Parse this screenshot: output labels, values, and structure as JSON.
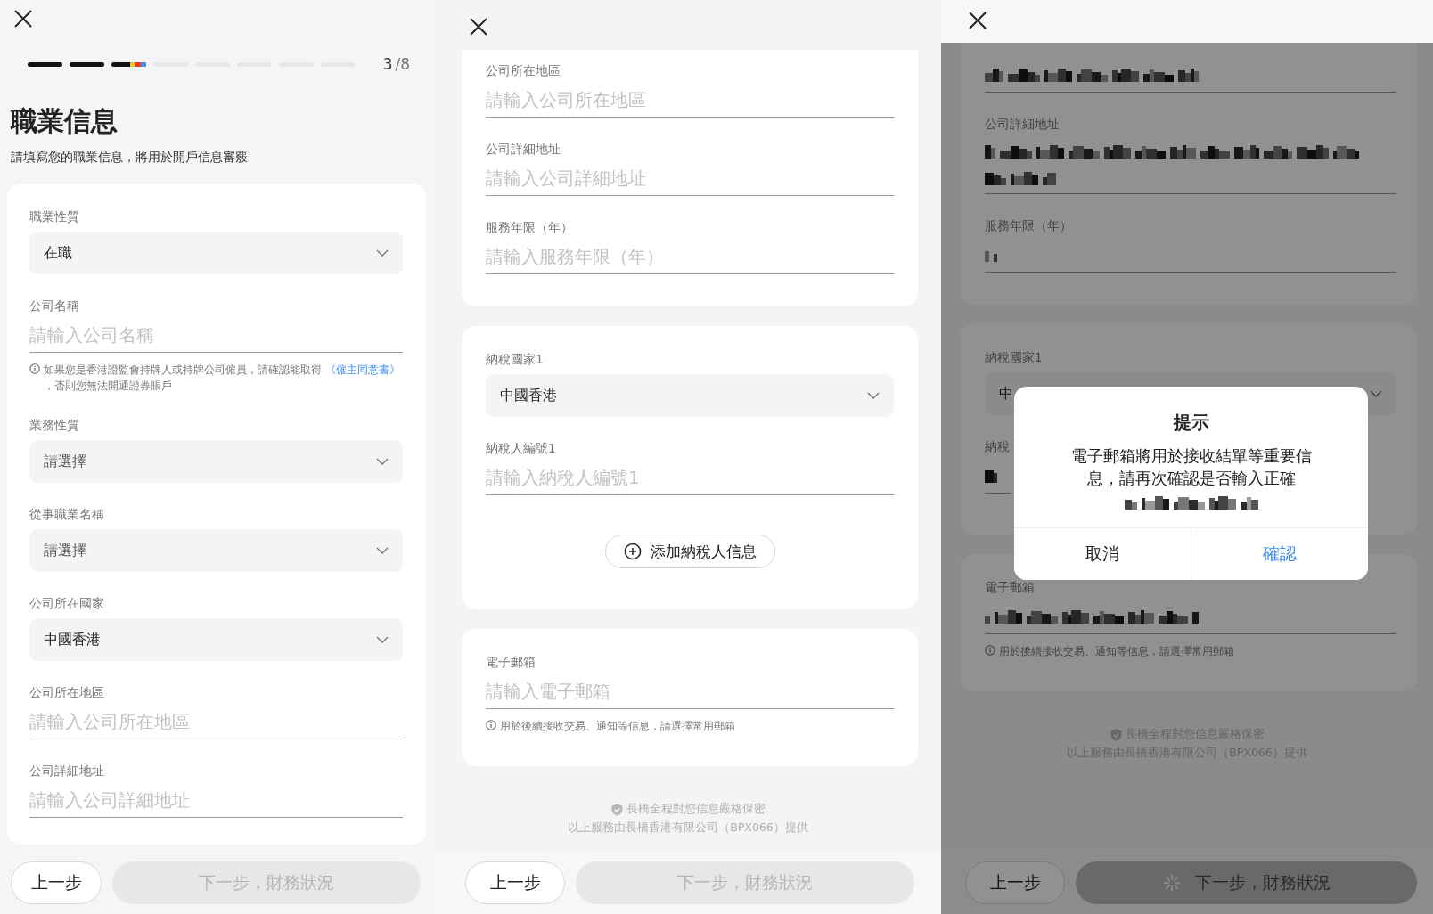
{
  "panels": [
    {
      "kind": "start",
      "progress": {
        "steps": [
          {
            "done": true,
            "selected": false
          },
          {
            "done": true,
            "selected": false
          },
          {
            "selected": true
          },
          {
            "done": false,
            "selected": false
          },
          {
            "done": false,
            "selected": false
          },
          {
            "done": false,
            "selected": false
          },
          {
            "done": false,
            "selected": false
          },
          {
            "done": false,
            "selected": false
          }
        ],
        "current": "3",
        "total": "/8"
      },
      "title": "職業信息",
      "subtitle": "請填寫您的職業信息，將用於開戶信息審覈",
      "cards": [
        {
          "fields": [
            {
              "kind": "select",
              "label": "職業性質",
              "value": "在職"
            },
            {
              "kind": "input",
              "label": "公司名稱",
              "placeholder": "請輸入公司名稱",
              "note": {
                "text": "如果您是香港證監會持牌人或持牌公司僱員，請確認能取得 ",
                "link": "《僱主同意書》",
                "after": " ，否則您無法開通證券賬戶"
              }
            },
            {
              "kind": "select",
              "label": "業務性質",
              "placeholder": "請選擇"
            },
            {
              "kind": "select",
              "label": "從事職業名稱",
              "placeholder": "請選擇"
            },
            {
              "kind": "select",
              "label": "公司所在國家",
              "value": "中國香港"
            },
            {
              "kind": "input",
              "label": "公司所在地區",
              "placeholder": "請輸入公司所在地區"
            },
            {
              "kind": "input",
              "label": "公司詳細地址",
              "placeholder": "請輸入公司詳細地址"
            }
          ]
        }
      ],
      "back_button": "上一步",
      "next_button": {
        "label": "下一步，財務狀況",
        "loading": false
      }
    },
    {
      "kind": "scrolled",
      "cards": [
        {
          "fields": [
            {
              "kind": "input",
              "label": "公司所在地區",
              "placeholder": "請輸入公司所在地區"
            },
            {
              "kind": "input",
              "label": "公司詳細地址",
              "placeholder": "請輸入公司詳細地址"
            },
            {
              "kind": "input",
              "label": "服務年限（年）",
              "placeholder": "請輸入服務年限（年）"
            }
          ]
        },
        {
          "fields": [
            {
              "kind": "select",
              "label": "納稅國家1",
              "value": "中國香港"
            },
            {
              "kind": "input",
              "label": "納稅人編號1",
              "placeholder": "請輸入納稅人編號1"
            }
          ],
          "add_button": "添加納稅人信息"
        },
        {
          "fields": [
            {
              "kind": "input",
              "label": "電子郵箱",
              "placeholder": "請輸入電子郵箱",
              "note": {
                "text": "用於後續接收交易、通知等信息，請選擇常用郵箱"
              }
            }
          ]
        }
      ],
      "footer": {
        "line1": "長橋全程對您信息嚴格保密",
        "line2": "以上服務由長橋香港有限公司（BPX066）提供"
      },
      "back_button": "上一步",
      "next_button": {
        "label": "下一步，財務狀況",
        "loading": false
      }
    },
    {
      "kind": "scrolled-dim",
      "cards": [
        {
          "fields": [
            {
              "kind": "masked"
            },
            {
              "kind": "masked2",
              "label": "公司詳細地址"
            },
            {
              "kind": "maskedtiny",
              "label": "服務年限（年）"
            }
          ]
        },
        {
          "fields": [
            {
              "kind": "select",
              "label": "納稅國家1",
              "value": "中"
            },
            {
              "kind": "maskedpartial",
              "label": "納稅"
            }
          ]
        },
        {
          "fields": [
            {
              "kind": "masked",
              "label": "電子郵箱",
              "note": {
                "text": "用於後續接收交易、通知等信息，請選擇常用郵箱"
              }
            }
          ]
        }
      ],
      "footer": {
        "line1": "長橋全程對您信息嚴格保密",
        "line2": "以上服務由長橋香港有限公司（BPX066）提供"
      },
      "back_button": "上一步",
      "next_button": {
        "label": "下一步，財務狀況",
        "loading": true
      },
      "dialog": {
        "title": "提示",
        "message": "電子郵箱將用於接收結單等重要信息，請再次確認是否輸入正確",
        "masked_email": true,
        "buttons": [
          {
            "label": "取消",
            "kind": "cancel"
          },
          {
            "label": "確認",
            "kind": "confirm"
          }
        ]
      }
    }
  ]
}
